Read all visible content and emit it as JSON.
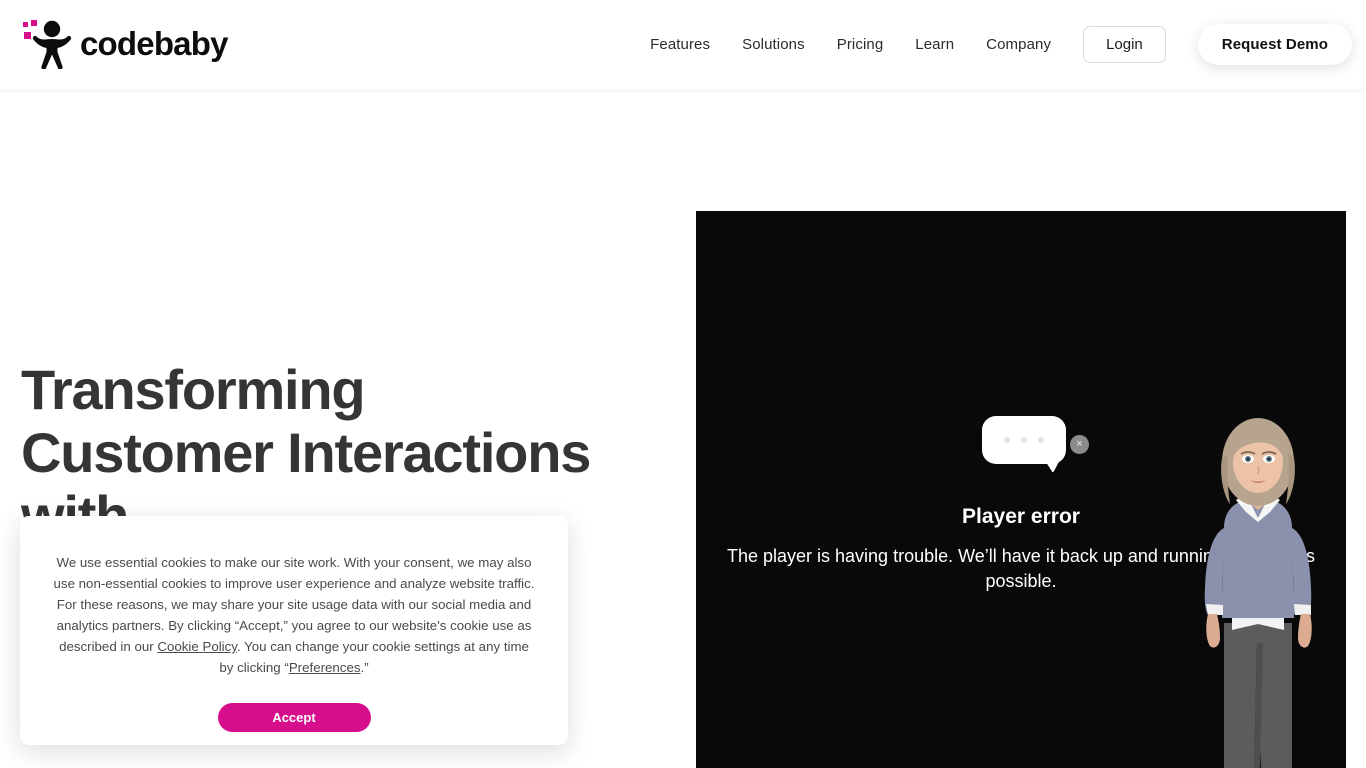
{
  "brand": {
    "name": "codebaby",
    "logo_icon": "codebaby-figure-icon",
    "accent_pink": "#d60e8c",
    "text_dark": "#0d0d0d"
  },
  "header": {
    "nav": [
      {
        "label": "Features",
        "name": "nav-features"
      },
      {
        "label": "Solutions",
        "name": "nav-solutions"
      },
      {
        "label": "Pricing",
        "name": "nav-pricing"
      },
      {
        "label": "Learn",
        "name": "nav-learn"
      },
      {
        "label": "Company",
        "name": "nav-company"
      }
    ],
    "login_label": "Login",
    "demo_label": "Request Demo"
  },
  "hero": {
    "heading_line1": "Transforming",
    "heading_line2": "Customer Interactions",
    "heading_line3": "with",
    "heading_full": "Transforming Customer Interactions with"
  },
  "player": {
    "background_color": "#090909",
    "error_title": "Player error",
    "error_message": "The player is having trouble. We’ll have it back up and running as soon as possible.",
    "bubble_dots": 3,
    "close_glyph": "×",
    "avatar_alt": "female avatar"
  },
  "cookie": {
    "paragraph_1": "We use essential cookies to make our site work. With your consent, we may also use non-essential cookies to improve user experience and analyze website traffic. For these reasons, we may share your site usage data with our social media and analytics partners. By clicking “Accept,” you agree to our website's cookie use as described in our ",
    "cookie_policy_link": "Cookie Policy",
    "paragraph_2": ". You can change your cookie settings at any time by clicking “",
    "preferences_link": "Preferences",
    "paragraph_3": ".”",
    "accept_label": "Accept"
  }
}
